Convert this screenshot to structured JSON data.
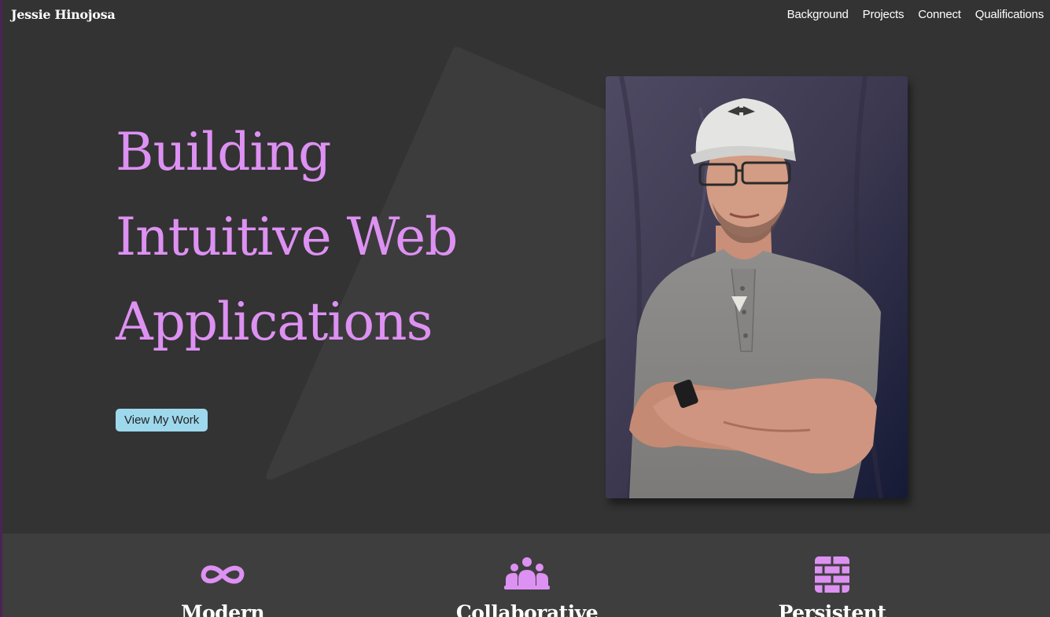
{
  "brand": "Jessie Hinojosa",
  "nav": {
    "items": [
      {
        "label": "Background"
      },
      {
        "label": "Projects"
      },
      {
        "label": "Connect"
      },
      {
        "label": "Qualifications"
      }
    ]
  },
  "hero": {
    "title_lines": [
      "Building",
      "Intuitive Web",
      "Applications"
    ],
    "cta_label": "View My Work"
  },
  "photo": {
    "alt": "portrait-photo"
  },
  "features": [
    {
      "title": "Modern",
      "icon": "infinity-icon"
    },
    {
      "title": "Collaborative",
      "icon": "people-group-icon"
    },
    {
      "title": "Persistent",
      "icon": "brick-wall-icon"
    }
  ],
  "colors": {
    "accent": "#dd91f2",
    "button": "#9ed8ec",
    "background": "#333333",
    "features_background": "#3e3e3e"
  }
}
